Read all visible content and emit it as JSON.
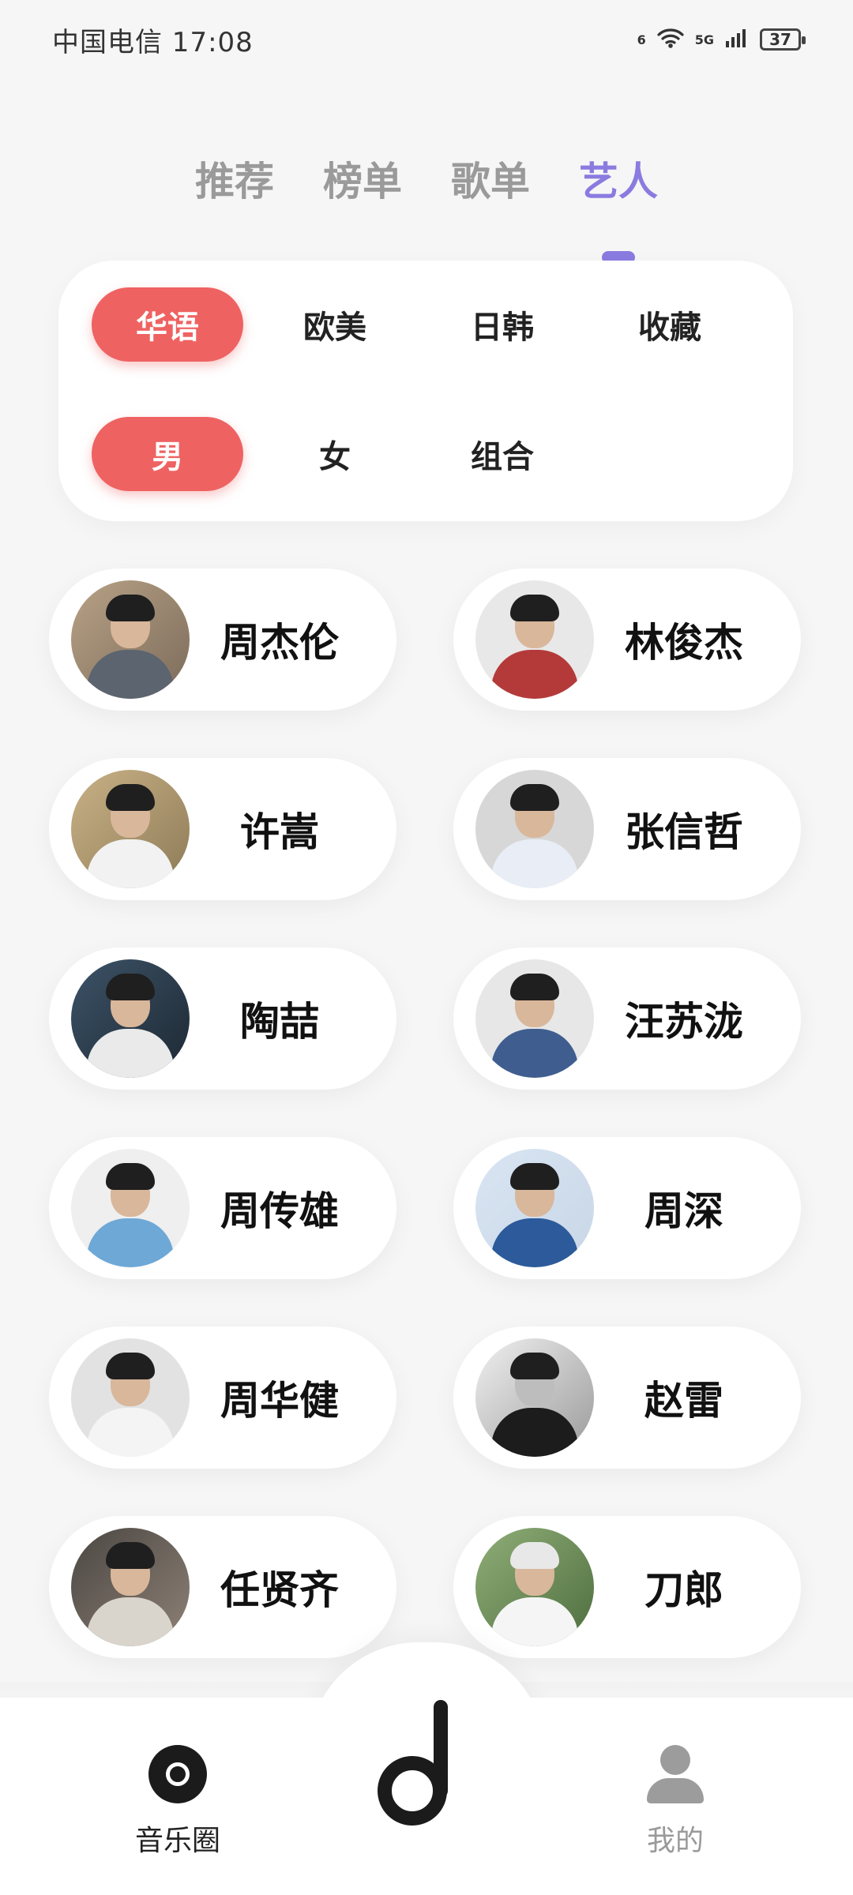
{
  "status_bar": {
    "carrier_time": "中国电信 17:08",
    "signal_label_1": "6",
    "signal_label_2": "5G",
    "battery": "37"
  },
  "top_tabs": [
    "推荐",
    "榜单",
    "歌单",
    "艺人"
  ],
  "filters": {
    "regions": [
      "华语",
      "欧美",
      "日韩",
      "收藏"
    ],
    "genders": [
      "男",
      "女",
      "组合"
    ]
  },
  "artists": [
    "周杰伦",
    "林俊杰",
    "许嵩",
    "张信哲",
    "陶喆",
    "汪苏泷",
    "周传雄",
    "周深",
    "周华健",
    "赵雷",
    "任贤齐",
    "刀郎"
  ],
  "bottom_nav": {
    "left": "音乐圈",
    "right": "我的"
  },
  "colors": {
    "accent_purple": "#8a7be0",
    "accent_red": "#ef6262"
  },
  "icons": {
    "wifi": "wifi-icon",
    "signal": "signal-icon",
    "battery": "battery-icon",
    "music_circle": "music-circle-icon",
    "profile": "profile-icon",
    "center_logo": "music-note-logo-icon"
  }
}
